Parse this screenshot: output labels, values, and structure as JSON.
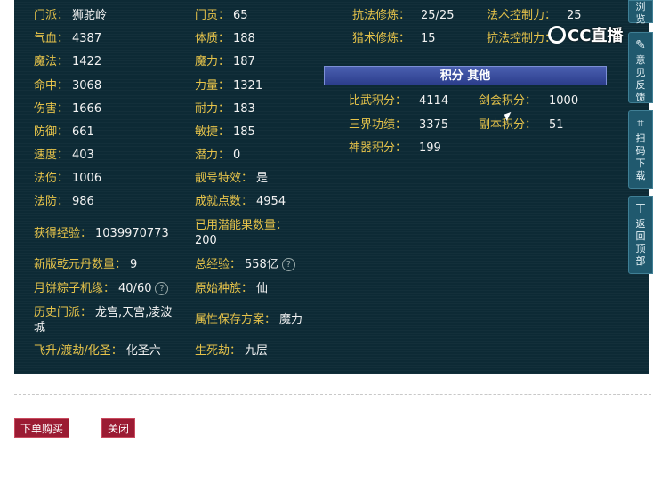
{
  "left_col": [
    {
      "label": "门派：",
      "value": "狮驼岭"
    },
    {
      "label": "气血：",
      "value": "4387"
    },
    {
      "label": "魔法：",
      "value": "1422"
    },
    {
      "label": "命中：",
      "value": "3068"
    },
    {
      "label": "伤害：",
      "value": "1666"
    },
    {
      "label": "防御：",
      "value": "661"
    },
    {
      "label": "速度：",
      "value": "403"
    },
    {
      "label": "法伤：",
      "value": "1006"
    },
    {
      "label": "法防：",
      "value": "986"
    },
    {
      "label": "获得经验：",
      "value": "1039970773"
    },
    {
      "label": "新版乾元丹数量：",
      "value": "9"
    },
    {
      "label": "月饼粽子机缘：",
      "value": "40/60"
    },
    {
      "label": "历史门派：",
      "value": "龙宫,天宫,凌波"
    },
    {
      "label": "",
      "value": "城"
    },
    {
      "label": "飞升/渡劫/化圣：",
      "value": "化圣六"
    }
  ],
  "mid_col": [
    {
      "label": "门贡：",
      "value": "65"
    },
    {
      "label": "体质：",
      "value": "188"
    },
    {
      "label": "魔力：",
      "value": "187"
    },
    {
      "label": "力量：",
      "value": "1321"
    },
    {
      "label": "耐力：",
      "value": "183"
    },
    {
      "label": "敏捷：",
      "value": "185"
    },
    {
      "label": "潜力：",
      "value": "0"
    },
    {
      "label": "靓号特效：",
      "value": "是"
    },
    {
      "label": "成就点数：",
      "value": "4954"
    },
    {
      "label": "已用潜能果数量：",
      "value": ""
    },
    {
      "label": "",
      "value": "200"
    },
    {
      "label": "总经验：",
      "value": "558亿"
    },
    {
      "label": "原始种族：",
      "value": "仙"
    },
    {
      "label": "属性保存方案：",
      "value": "魔力"
    },
    {
      "label": "生死劫：",
      "value": "九层"
    }
  ],
  "right_top": [
    {
      "label": "抗法修炼：",
      "value": "25/25"
    },
    {
      "label": "法术控制力：",
      "value": "25"
    },
    {
      "label": "猎术修炼：",
      "value": "15"
    },
    {
      "label": "抗法控制力：",
      "value": ""
    }
  ],
  "section_title": "积分 其他",
  "points": [
    {
      "label": "比武积分：",
      "value": "4114"
    },
    {
      "label": "剑会积分：",
      "value": "1000"
    },
    {
      "label": "三界功绩：",
      "value": "3375"
    },
    {
      "label": "副本积分：",
      "value": "51"
    },
    {
      "label": "神器积分：",
      "value": "199"
    }
  ],
  "buttons": {
    "buy": "下单购买",
    "close": "关闭"
  },
  "sidebar": [
    {
      "icon": "browse-icon",
      "text": "浏览"
    },
    {
      "icon": "edit-icon",
      "text": "意见反馈"
    },
    {
      "icon": "scan-icon",
      "text": "扫码下载"
    },
    {
      "icon": "arrow-up-icon",
      "text": "返回顶部"
    }
  ],
  "watermark": "CC直播"
}
